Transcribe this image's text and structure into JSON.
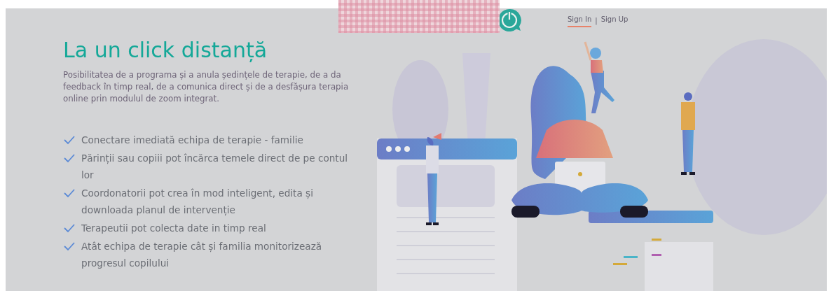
{
  "header": {
    "nav": [
      {
        "label": "Sign In",
        "selected": true
      },
      {
        "label": "Sign Up",
        "selected": false
      }
    ],
    "separator": "|"
  },
  "hero": {
    "title": "La un click distanță",
    "description": "Posibilitatea de a programa și a anula ședințele de terapie, de a da feedback în timp real, de a comunica direct și de a desfășura terapia online prin modulul de zoom integrat.",
    "features": [
      "Conectare imediată echipa de terapie - familie",
      "Părinții sau copiii pot încărca temele direct de pe contul lor",
      "Coordonatorii pot crea în mod inteligent, edita și downloada planul de intervenție",
      "Terapeutii pot colecta date in timp real",
      "Atât echipa de terapie cât și familia monitorizează progresul copilului"
    ]
  }
}
